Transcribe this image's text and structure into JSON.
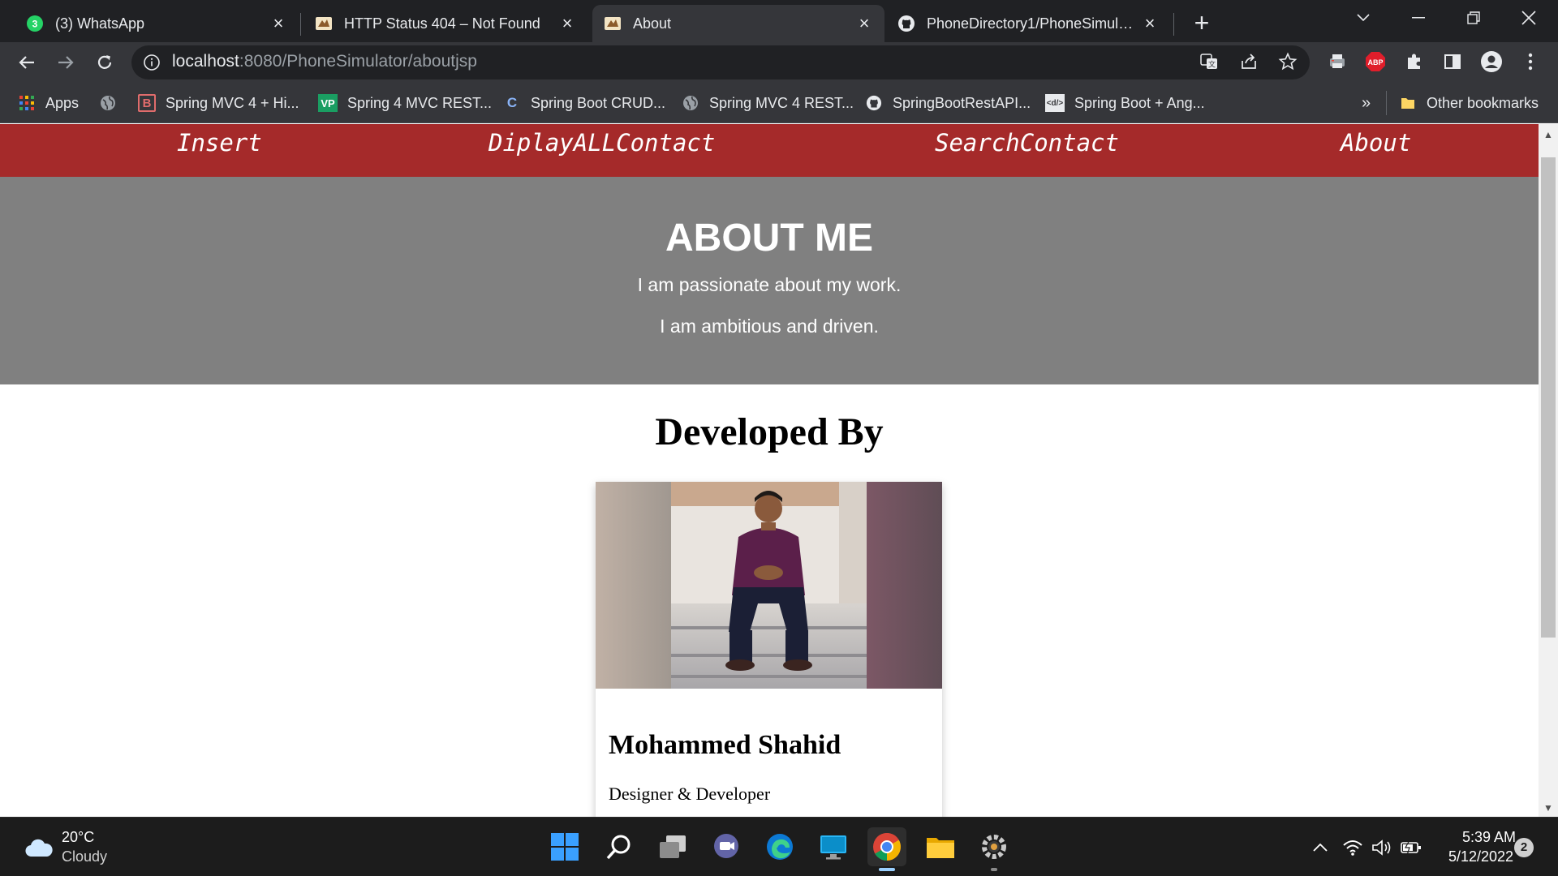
{
  "browser": {
    "tabs": [
      {
        "title": "(3) WhatsApp",
        "badge": "3",
        "icon": "whatsapp-icon"
      },
      {
        "title": "HTTP Status 404 – Not Found",
        "icon": "tomcat-icon"
      },
      {
        "title": "About",
        "icon": "tomcat-icon",
        "active": true
      },
      {
        "title": "PhoneDirectory1/PhoneSimulator",
        "icon": "github-icon"
      }
    ],
    "url": {
      "host": "localhost",
      "path": ":8080/PhoneSimulator/aboutjsp"
    },
    "bookmarks": [
      {
        "label": "Apps",
        "icon": "apps-grid-icon"
      },
      {
        "label": "",
        "icon": "globe-icon"
      },
      {
        "label": "Spring MVC 4 + Hi...",
        "icon": "bootstrap-b-icon",
        "icon_text": "B"
      },
      {
        "label": "Spring 4 MVC REST...",
        "icon": "vp-icon",
        "icon_text": "VP"
      },
      {
        "label": "Spring Boot CRUD...",
        "icon": "c-logo-icon",
        "icon_text": "C"
      },
      {
        "label": "Spring MVC 4 REST...",
        "icon": "globe-icon"
      },
      {
        "label": "SpringBootRestAPI...",
        "icon": "github-icon"
      },
      {
        "label": "Spring Boot + Ang...",
        "icon": "code-icon",
        "icon_text": "<d/>"
      }
    ],
    "bookmarks_overflow": "»",
    "other_bookmarks": "Other bookmarks",
    "extension_abp": "ABP"
  },
  "page": {
    "nav": [
      "Insert",
      "DiplayALLContact",
      "SearchContact",
      "About"
    ],
    "hero": {
      "title": "ABOUT ME",
      "line1": "I am passionate about my work.",
      "line2": "I am ambitious and driven."
    },
    "developed_by": "Developed By",
    "card": {
      "name": "Mohammed Shahid",
      "role": "Designer & Developer"
    },
    "colors": {
      "navbar": "#a52a2a",
      "hero": "#808080"
    }
  },
  "taskbar": {
    "weather": {
      "temp": "20°C",
      "desc": "Cloudy"
    },
    "clock": {
      "time": "5:39 AM",
      "date": "5/12/2022"
    },
    "notifications": "2"
  }
}
